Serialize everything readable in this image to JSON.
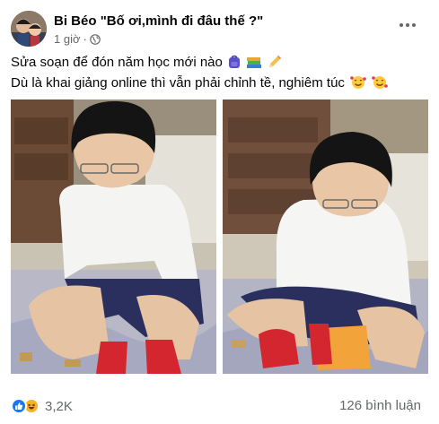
{
  "post": {
    "author": "Bi Béo",
    "group_title": "\"Bố ơi,mình đi đâu thế ?\"",
    "timestamp": "1 giờ",
    "separator": "·",
    "audience_icon": "globe-icon",
    "caption_lines": [
      "Sửa soạn để đón năm học mới nào",
      "Dù là khai giảng online thì vẫn phải chỉnh tề, nghiêm túc"
    ],
    "caption_icons": [
      "backpack-icon",
      "books-icon",
      "pencil-icon",
      "smiling-hearts-face-icon",
      "smiling-hearts-face-icon"
    ]
  },
  "photos": [
    {
      "name": "boy-putting-on-red-socks-photo-1"
    },
    {
      "name": "boy-putting-on-red-socks-photo-2"
    }
  ],
  "engagement": {
    "reaction_icons": [
      "like-icon",
      "haha-icon"
    ],
    "reaction_count": "3,2K",
    "comment_count": "126 bình luận"
  },
  "colors": {
    "text_primary": "#050505",
    "text_secondary": "#65676b",
    "like_blue": "#1877f2",
    "haha_yellow": "#f7b125"
  }
}
